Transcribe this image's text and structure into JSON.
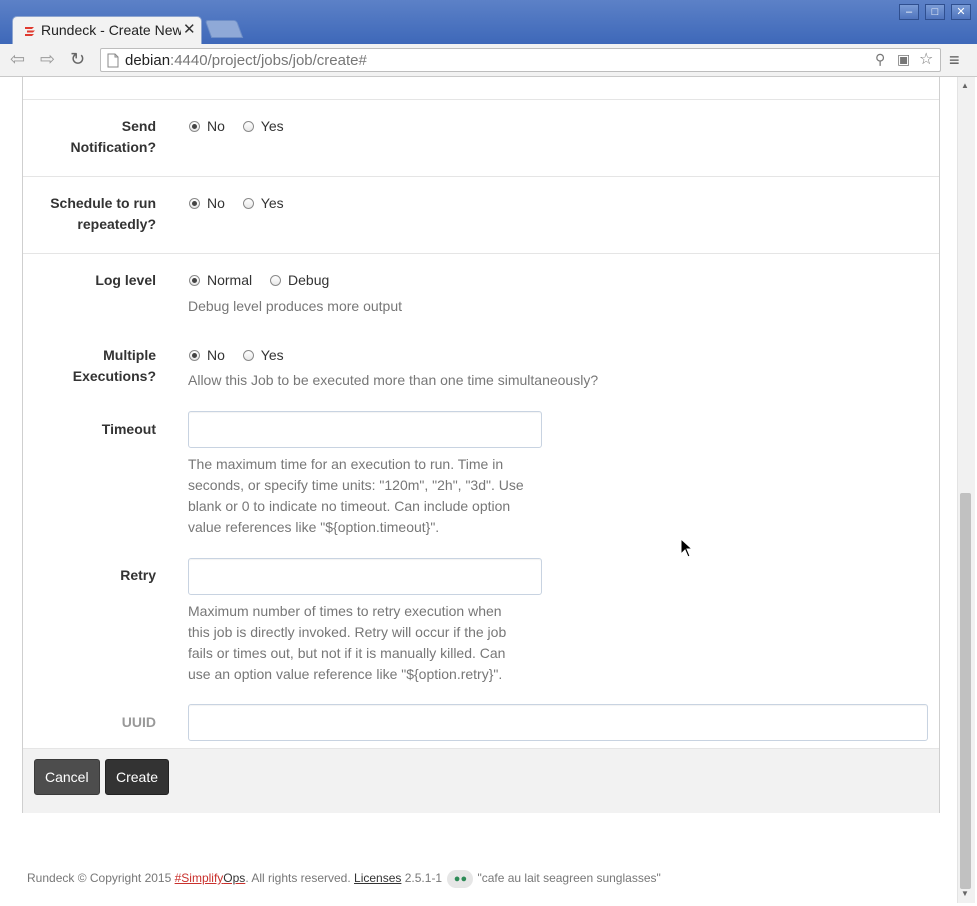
{
  "browser": {
    "tab_title": "Rundeck - Create New Job",
    "url_host": "debian",
    "url_rest": ":4440/project/jobs/job/create#"
  },
  "form": {
    "send_notification": {
      "label_line1": "Send",
      "label_line2": "Notification?",
      "options": [
        "No",
        "Yes"
      ],
      "selected": "No"
    },
    "schedule": {
      "label_line1": "Schedule to run",
      "label_line2": "repeatedly?",
      "options": [
        "No",
        "Yes"
      ],
      "selected": "No"
    },
    "log_level": {
      "label": "Log level",
      "options": [
        "Normal",
        "Debug"
      ],
      "selected": "Normal",
      "help": "Debug level produces more output"
    },
    "multiple_executions": {
      "label_line1": "Multiple",
      "label_line2": "Executions?",
      "options": [
        "No",
        "Yes"
      ],
      "selected": "No",
      "help": "Allow this Job to be executed more than one time simultaneously?"
    },
    "timeout": {
      "label": "Timeout",
      "value": "",
      "help_lines": [
        "The maximum time for an execution to run. Time in",
        "seconds, or specify time units: \"120m\", \"2h\", \"3d\". Use",
        "blank or 0 to indicate no timeout. Can include option",
        "value references like \"${option.timeout}\"."
      ]
    },
    "retry": {
      "label": "Retry",
      "value": "",
      "help_lines": [
        "Maximum number of times to retry execution when",
        "this job is directly invoked. Retry will occur if the job",
        "fails or times out, but not if it is manually killed. Can",
        "use an option value reference like \"${option.retry}\"."
      ]
    },
    "uuid": {
      "label": "UUID",
      "value": ""
    },
    "buttons": {
      "cancel": "Cancel",
      "create": "Create"
    }
  },
  "footer": {
    "copyright": "Rundeck © Copyright 2015",
    "simplify_hash": "#Simplify",
    "simplify_ops": "Ops",
    "rights": ". All rights reserved.",
    "licenses": "Licenses",
    "version": "2.5.1-1",
    "codename": "\"cafe au lait seagreen sunglasses\""
  },
  "colors": {
    "brand_red": "#c9302c",
    "button_dark": "#333333",
    "codename_green": "#2e8b57"
  }
}
